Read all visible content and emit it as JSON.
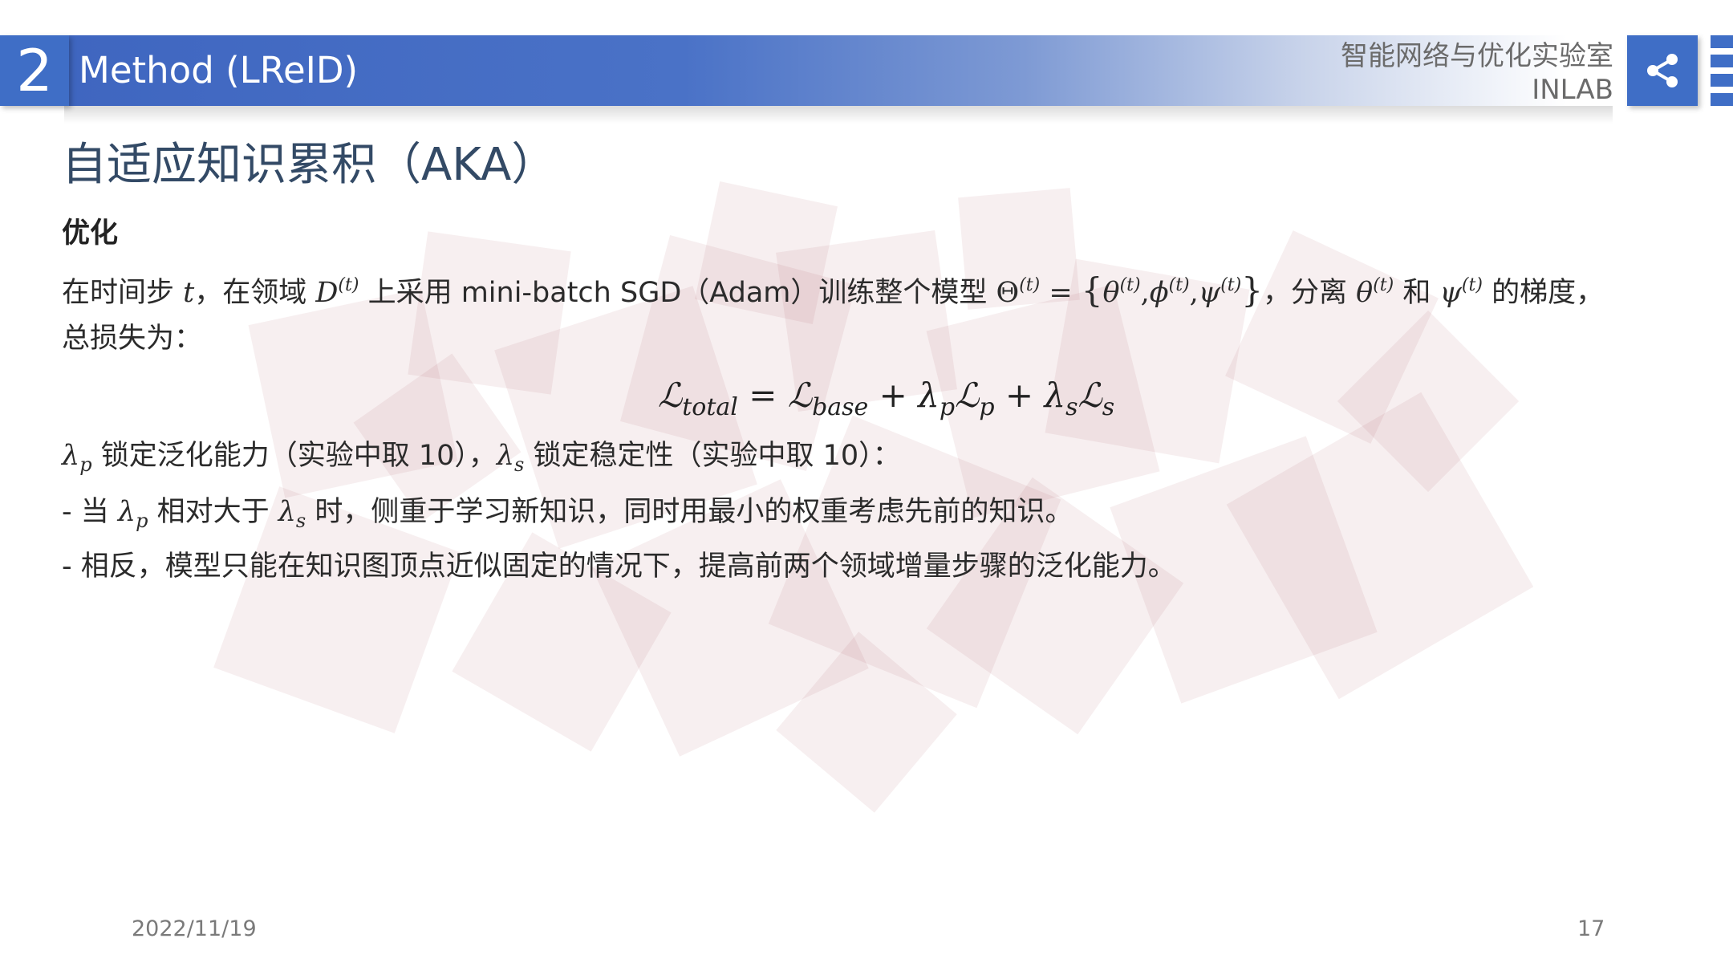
{
  "header": {
    "section_number": "2",
    "section_title": "Method (LReID)",
    "lab_name": "智能网络与优化实验室",
    "lab_abbr": "INLAB",
    "share_icon": "share-icon",
    "accent_color": "#3f6ec6"
  },
  "slide": {
    "title": "自适应知识累积（AKA）",
    "subheading": "优化",
    "para1": {
      "t1": "在时间步 ",
      "v_t": "t",
      "t2": "，在领域 ",
      "v_D": "D",
      "sup_t": "(t)",
      "t3": " 上采用 mini-batch SGD（Adam）训练整个模型 ",
      "v_Theta": "Θ",
      "t4": " = ",
      "set_open": "{",
      "v_theta": "θ",
      "v_phi": "ϕ",
      "v_psi": "ψ",
      "comma": ",",
      "set_close": "}",
      "t5": "，分离 ",
      "t6": " 和 ",
      "t7": " 的梯度，",
      "line2": "总损失为："
    },
    "equation": {
      "L": "ℒ",
      "total": "total",
      "eq": " = ",
      "base": "base",
      "plus": " + ",
      "lambda": "λ",
      "p": "p",
      "s": "s"
    },
    "line_lambda": {
      "v_lambda": "λ",
      "sub_p": "p",
      "sub_s": "s",
      "t1": " 锁定泛化能力（实验中取 10），",
      "t2": " 锁定稳定性（实验中取 10）："
    },
    "bullet1": {
      "t1": "- 当 ",
      "t2": " 相对大于 ",
      "t3": " 时，侧重于学习新知识，同时用最小的权重考虑先前的知识。"
    },
    "bullet2": "- 相反，模型只能在知识图顶点近似固定的情况下，提高前两个领域增量步骤的泛化能力。"
  },
  "footer": {
    "date": "2022/11/19",
    "page_number": "17"
  }
}
